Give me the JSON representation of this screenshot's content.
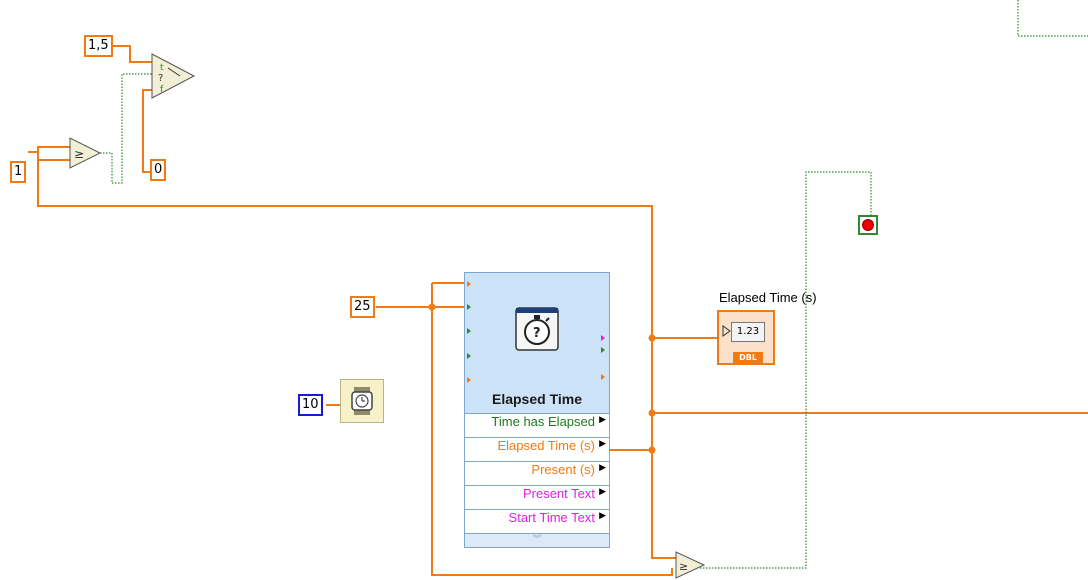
{
  "constants": {
    "c_1_5": "1,5",
    "c_0": "0",
    "c_1": "1",
    "c_25": "25",
    "c_10": "10"
  },
  "express_vi": {
    "title": "Elapsed Time",
    "outputs": [
      {
        "label": "Time has Elapsed",
        "color": "#1d7a1d"
      },
      {
        "label": "Elapsed Time (s)",
        "color": "#f07a14"
      },
      {
        "label": "Present (s)",
        "color": "#f07a14"
      },
      {
        "label": "Present Text",
        "color": "#e020e0"
      },
      {
        "label": "Start Time Text",
        "color": "#e020e0"
      }
    ]
  },
  "indicator": {
    "label": "Elapsed Time (s)",
    "display": "1.23",
    "type_tag": "DBL"
  },
  "colors": {
    "numeric_wire": "#f07a14",
    "boolean_wire": "#2f8a2f",
    "i32_constant": "#1a1ad0"
  },
  "icons": [
    "select-function-icon",
    "greater-or-equal-icon",
    "stopwatch-icon",
    "wait-ms-icon",
    "stop-terminal-icon"
  ]
}
